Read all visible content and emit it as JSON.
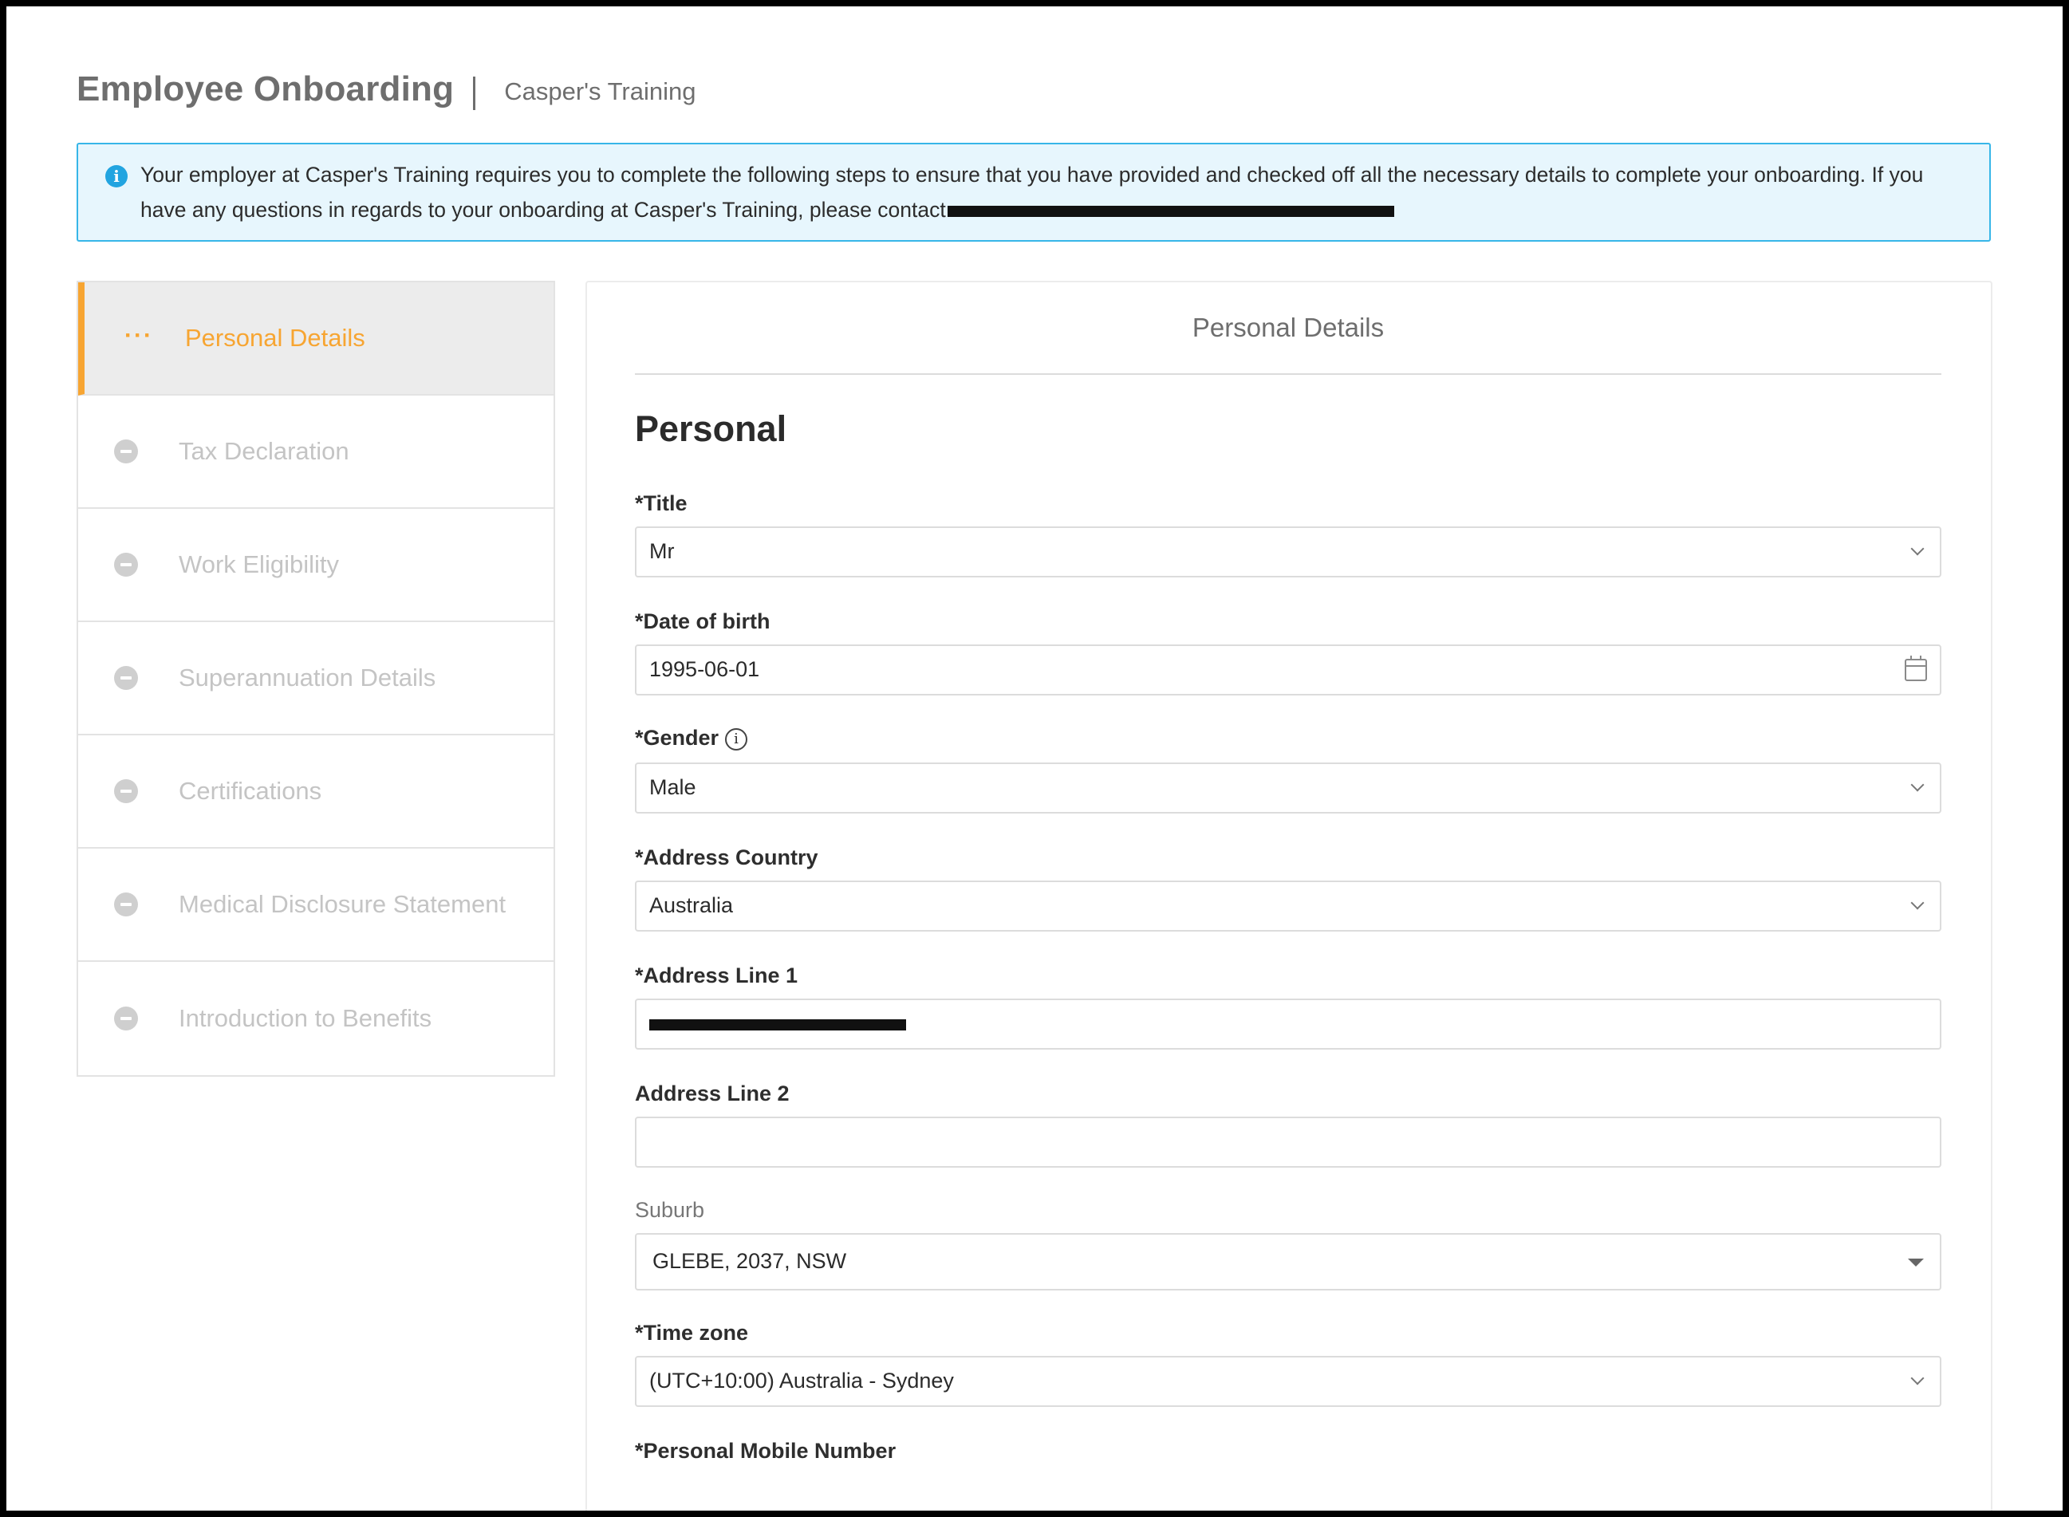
{
  "header": {
    "title": "Employee Onboarding",
    "company": "Casper's Training"
  },
  "banner": {
    "text": "Your employer at Casper's Training requires you to complete the following steps to ensure that you have provided and checked off all the necessary details to complete your onboarding. If you have any questions in regards to your onboarding at Casper's Training, please contact"
  },
  "sidebar": {
    "items": [
      {
        "label": "Personal Details",
        "state": "active"
      },
      {
        "label": "Tax Declaration",
        "state": "pending"
      },
      {
        "label": "Work Eligibility",
        "state": "pending"
      },
      {
        "label": "Superannuation Details",
        "state": "pending"
      },
      {
        "label": "Certifications",
        "state": "pending"
      },
      {
        "label": "Medical Disclosure Statement",
        "state": "pending"
      },
      {
        "label": "Introduction to Benefits",
        "state": "pending"
      }
    ]
  },
  "panel": {
    "title": "Personal Details",
    "section": "Personal",
    "fields": {
      "title": {
        "label": "*Title",
        "value": "Mr"
      },
      "dob": {
        "label": "*Date of birth",
        "value": "1995-06-01"
      },
      "gender": {
        "label": "*Gender",
        "value": "Male"
      },
      "country": {
        "label": "*Address Country",
        "value": "Australia"
      },
      "address1": {
        "label": "*Address Line 1",
        "value": ""
      },
      "address2": {
        "label": "Address Line 2",
        "value": ""
      },
      "suburb": {
        "label": "Suburb",
        "value": "GLEBE, 2037, NSW"
      },
      "timezone": {
        "label": "*Time zone",
        "value": "(UTC+10:00) Australia - Sydney"
      },
      "mobile": {
        "label": "*Personal Mobile Number"
      }
    }
  },
  "colors": {
    "accent": "#f7a532",
    "info": "#37b6e8",
    "infoBg": "#e7f6fd"
  }
}
